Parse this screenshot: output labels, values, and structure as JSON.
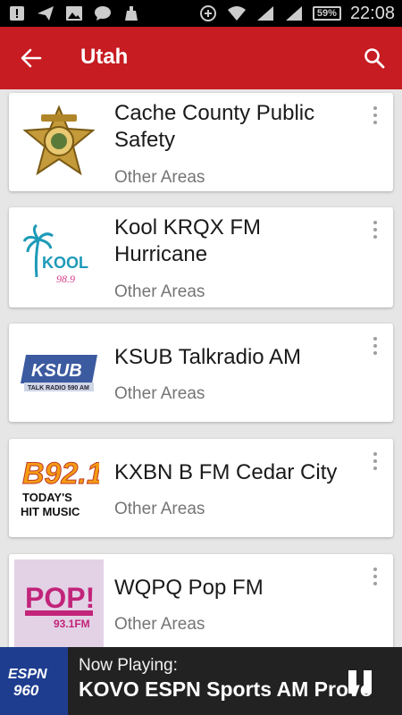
{
  "status_bar": {
    "time": "22:08",
    "battery": "59%",
    "icons_left": [
      "notification-icon",
      "send-icon",
      "image-icon",
      "chat-icon",
      "cleaner-icon"
    ],
    "icons_right": [
      "data-icon",
      "wifi-icon",
      "signal-icon",
      "signal-2-icon"
    ]
  },
  "app_bar": {
    "title": "Utah",
    "back_icon": "arrow-left-icon",
    "search_icon": "search-icon",
    "color": "#c71c22"
  },
  "stations": [
    {
      "name": "Cache County Public Safety",
      "category": "Other Areas",
      "logo": "sheriff-badge-logo"
    },
    {
      "name": "Kool KRQX FM Hurricane",
      "category": "Other Areas",
      "logo": "kool-logo",
      "logo_text": "KOOL",
      "logo_sub": "98.9"
    },
    {
      "name": "KSUB Talkradio AM",
      "category": "Other Areas",
      "logo": "ksub-logo",
      "logo_text": "KSUB",
      "logo_sub": "TALK RADIO 590 AM"
    },
    {
      "name": "KXBN B FM Cedar City",
      "category": "Other Areas",
      "logo": "b921-logo",
      "logo_text": "B92.1",
      "logo_sub": "TODAY'S HIT MUSIC"
    },
    {
      "name": "WQPQ Pop FM",
      "category": "Other Areas",
      "logo": "pop-logo",
      "logo_text": "POP!",
      "logo_sub": "93.1FM"
    }
  ],
  "now_playing": {
    "label": "Now Playing:",
    "station": "KOVO ESPN Sports AM Provo",
    "logo_text": "ESPN 960",
    "control_icon": "pause-icon"
  }
}
